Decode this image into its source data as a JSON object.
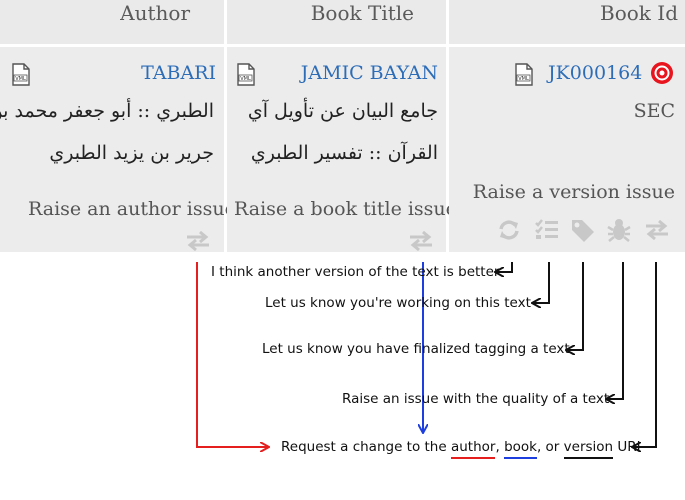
{
  "headers": {
    "author": "Author",
    "book_title": "Book Title",
    "book_id": "Book Id"
  },
  "author_cell": {
    "link": "TABARI",
    "arabic_line1": "الطبري :: أبو جعفر محمد بن",
    "arabic_line2": "جرير بن يزيد الطبري",
    "raise": "Raise an author issue"
  },
  "book_cell": {
    "link": "JAMIC BAYAN",
    "arabic_line1": "جامع البيان عن تأويل آي",
    "arabic_line2": "القرآن :: تفسير الطبري",
    "raise": "Raise a book title issue"
  },
  "id_cell": {
    "link": "JK000164",
    "sec": "SEC",
    "raise": "Raise a version issue"
  },
  "icons": {
    "file": "vml-file-icon",
    "target": "target-icon",
    "sync": "sync-icon",
    "tasks": "tasks-icon",
    "tag": "tag-icon",
    "bug": "bug-icon",
    "exchange": "exchange-icon"
  },
  "annotations": {
    "better_version": "I think another version of the text is better",
    "working": "Let us know you're working on this text",
    "finalized": "Let us know you have finalized tagging a text",
    "quality": "Raise an issue with the quality of a text",
    "request_prefix": "Request a change to the ",
    "request_author": "author",
    "request_sep1": ", ",
    "request_book": "book",
    "request_sep2": ", or ",
    "request_version": "version",
    "request_suffix": " URI"
  },
  "colors": {
    "link": "#2d6db8",
    "red_arrow": "#e51e1e",
    "blue_arrow": "#1d3fe0",
    "icon_gray": "#c8c8c8",
    "target_red": "#e8141e"
  }
}
